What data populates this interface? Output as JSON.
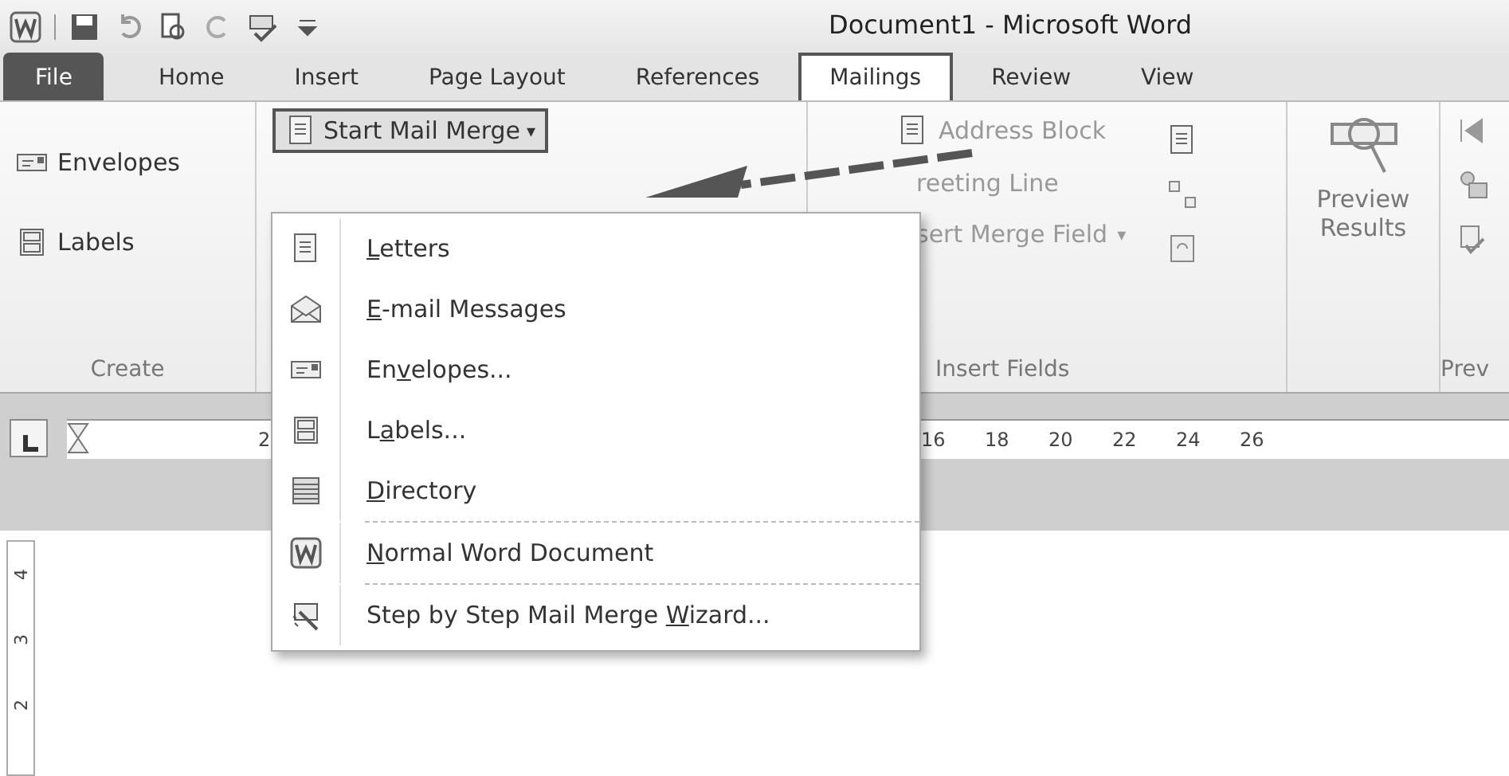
{
  "window": {
    "title": "Document1  -  Microsoft Word"
  },
  "tabs": [
    {
      "label": "File",
      "kind": "file",
      "selected": false
    },
    {
      "label": "Home",
      "kind": "tab",
      "selected": false
    },
    {
      "label": "Insert",
      "kind": "tab",
      "selected": false
    },
    {
      "label": "Page Layout",
      "kind": "tab",
      "selected": false
    },
    {
      "label": "References",
      "kind": "tab",
      "selected": false
    },
    {
      "label": "Mailings",
      "kind": "tab",
      "selected": true
    },
    {
      "label": "Review",
      "kind": "tab",
      "selected": false
    },
    {
      "label": "View",
      "kind": "tab",
      "selected": false
    }
  ],
  "ribbon": {
    "create": {
      "items": [
        {
          "label": "Envelopes",
          "kind": "envelope",
          "disabled": false
        },
        {
          "label": "Labels",
          "kind": "labels",
          "disabled": false
        }
      ],
      "group_label": "Create"
    },
    "start_mail_merge": {
      "label": "Start Mail Merge",
      "caret": "▾",
      "expanded": true
    },
    "insert_fields": {
      "items": [
        {
          "label": "Address Block",
          "disabled": true
        },
        {
          "label": "reeting Line",
          "disabled": true
        },
        {
          "label": "sert Merge Field",
          "caret": "▾",
          "disabled": true
        }
      ],
      "group_label": "Insert Fields"
    },
    "preview": {
      "label_lines": [
        "Preview",
        "Results"
      ],
      "group_label": "Prev"
    }
  },
  "ruler": {
    "ticks": [
      "2",
      "16",
      "18",
      "20",
      "22",
      "24",
      "26"
    ],
    "vertical_ticks": [
      "4",
      "3",
      "2"
    ]
  },
  "menu": {
    "items": [
      {
        "key": "L",
        "post": "etters",
        "kind": "letter",
        "separator_before": false
      },
      {
        "key": "E",
        "post": "-mail Messages",
        "kind": "email",
        "separator_before": false
      },
      {
        "pre": "En",
        "key": "v",
        "post": "elopes...",
        "kind": "envelope",
        "separator_before": false
      },
      {
        "pre": "L",
        "key": "a",
        "post": "bels...",
        "kind": "labels",
        "separator_before": false
      },
      {
        "key": "D",
        "post": "irectory",
        "kind": "directory",
        "separator_before": false
      },
      {
        "key": "N",
        "post": "ormal Word Document",
        "kind": "word",
        "separator_before": true
      },
      {
        "pre": "Step by Step Mail Merge ",
        "key": "W",
        "post": "izard...",
        "kind": "wizard",
        "separator_before": true
      }
    ]
  }
}
